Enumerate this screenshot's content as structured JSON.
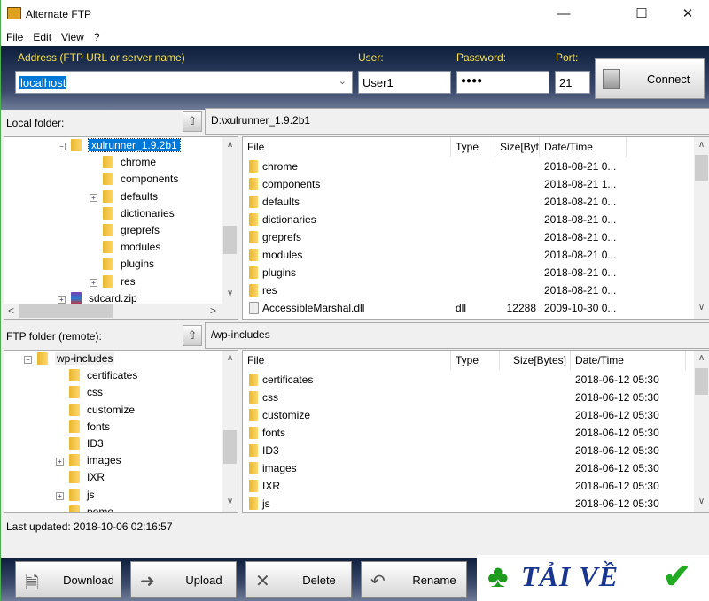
{
  "window": {
    "title": "Alternate FTP",
    "controls": [
      "minimize",
      "maximize",
      "close"
    ]
  },
  "menu": [
    "File",
    "Edit",
    "View",
    "?"
  ],
  "connection": {
    "address_label": "Address (FTP URL or server name)",
    "address_value": "localhost",
    "user_label": "User:",
    "user_value": "User1",
    "password_label": "Password:",
    "password_value": "●●●●",
    "port_label": "Port:",
    "port_value": "21",
    "connect_label": "Connect"
  },
  "local": {
    "label": "Local folder:",
    "path": "D:\\xulrunner_1.9.2b1",
    "tree": [
      {
        "name": "xulrunner_1.9.2b1",
        "selected": true,
        "expander": "minus"
      },
      {
        "name": "chrome"
      },
      {
        "name": "components"
      },
      {
        "name": "defaults",
        "expander": "plus"
      },
      {
        "name": "dictionaries"
      },
      {
        "name": "greprefs"
      },
      {
        "name": "modules"
      },
      {
        "name": "plugins"
      },
      {
        "name": "res",
        "expander": "plus"
      },
      {
        "name": "sdcard.zip",
        "expander": "plus",
        "zip": true
      }
    ],
    "columns": [
      "File",
      "Type",
      "Size[Byt",
      "Date/Time"
    ],
    "files": [
      [
        "chrome",
        "",
        "",
        "2018-08-21 0..."
      ],
      [
        "components",
        "",
        "",
        "2018-08-21 1..."
      ],
      [
        "defaults",
        "",
        "",
        "2018-08-21 0..."
      ],
      [
        "dictionaries",
        "",
        "",
        "2018-08-21 0..."
      ],
      [
        "greprefs",
        "",
        "",
        "2018-08-21 0..."
      ],
      [
        "modules",
        "",
        "",
        "2018-08-21 0..."
      ],
      [
        "plugins",
        "",
        "",
        "2018-08-21 0..."
      ],
      [
        "res",
        "",
        "",
        "2018-08-21 0..."
      ],
      [
        "AccessibleMarshal.dll",
        "dll",
        "12288",
        "2009-10-30 0..."
      ]
    ]
  },
  "remote": {
    "label": "FTP folder (remote):",
    "path": "/wp-includes",
    "tree": [
      {
        "name": "wp-includes",
        "expander": "minus"
      },
      {
        "name": "certificates"
      },
      {
        "name": "css"
      },
      {
        "name": "customize"
      },
      {
        "name": "fonts"
      },
      {
        "name": "ID3"
      },
      {
        "name": "images",
        "expander": "plus"
      },
      {
        "name": "IXR"
      },
      {
        "name": "js",
        "expander": "plus"
      },
      {
        "name": "pomo"
      }
    ],
    "columns": [
      "File",
      "Type",
      "Size[Bytes]",
      "Date/Time"
    ],
    "files": [
      [
        "certificates",
        "",
        "",
        "2018-06-12 05:30"
      ],
      [
        "css",
        "",
        "",
        "2018-06-12 05:30"
      ],
      [
        "customize",
        "",
        "",
        "2018-06-12 05:30"
      ],
      [
        "fonts",
        "",
        "",
        "2018-06-12 05:30"
      ],
      [
        "ID3",
        "",
        "",
        "2018-06-12 05:30"
      ],
      [
        "images",
        "",
        "",
        "2018-06-12 05:30"
      ],
      [
        "IXR",
        "",
        "",
        "2018-06-12 05:30"
      ],
      [
        "js",
        "",
        "",
        "2018-06-12 05:30"
      ]
    ]
  },
  "status": "Last updated: 2018-10-06 02:16:57",
  "toolbar": [
    {
      "label": "Download",
      "icon": "download-icon"
    },
    {
      "label": "Upload",
      "icon": "upload-icon"
    },
    {
      "label": "Delete",
      "icon": "delete-icon"
    },
    {
      "label": "Rename",
      "icon": "rename-icon"
    }
  ],
  "watermark": {
    "text": "TẢI VỀ",
    "colors": {
      "text": "#1a3590",
      "clover": "#1e9a1e",
      "check": "#22aa22"
    }
  },
  "colors": {
    "header": "#0d1f3d",
    "label_yellow": "#f4e04d",
    "selection": "#0078d7",
    "folder": "#e8b730"
  }
}
